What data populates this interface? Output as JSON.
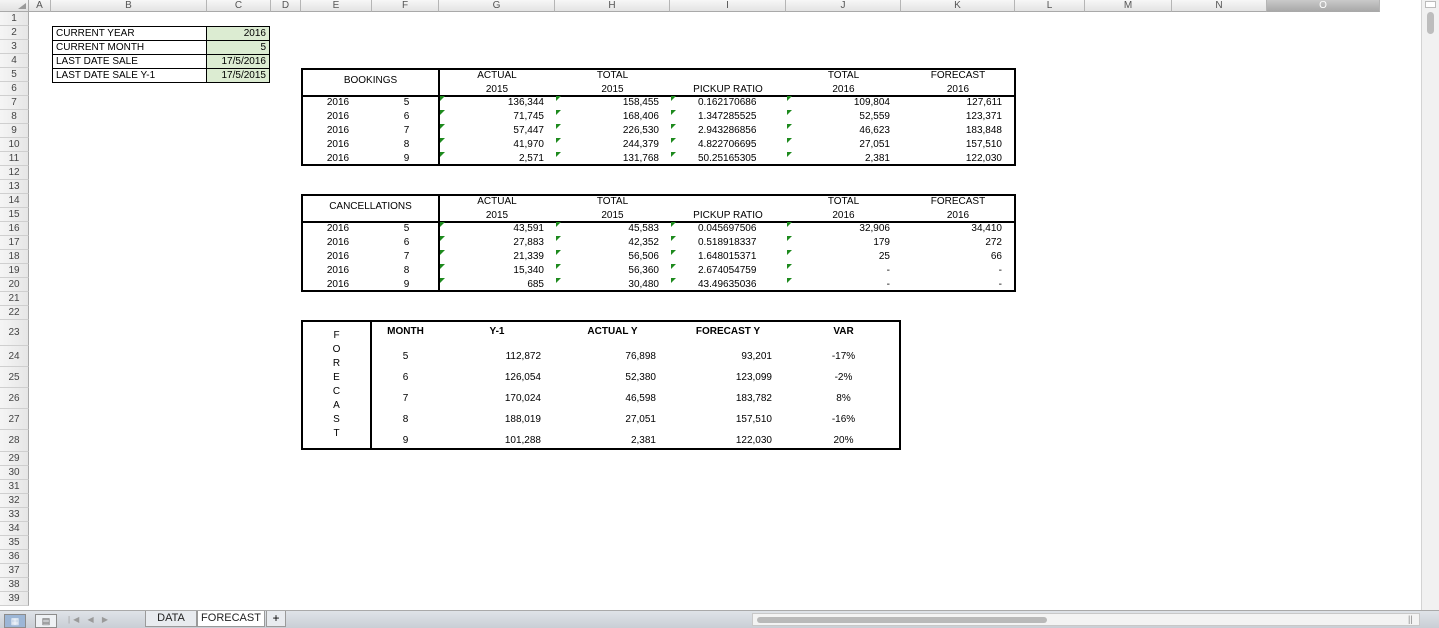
{
  "columns": [
    "A",
    "B",
    "C",
    "D",
    "E",
    "F",
    "G",
    "H",
    "I",
    "J",
    "K",
    "L",
    "M",
    "N",
    "O"
  ],
  "rows": [
    "1",
    "2",
    "3",
    "4",
    "5",
    "6",
    "7",
    "8",
    "9",
    "10",
    "11",
    "12",
    "13",
    "14",
    "15",
    "16",
    "17",
    "18",
    "19",
    "20",
    "21",
    "22",
    "23",
    "24",
    "25",
    "26",
    "27",
    "28",
    "29",
    "30",
    "31",
    "32",
    "33",
    "34",
    "35",
    "36",
    "37",
    "38",
    "39"
  ],
  "info": [
    {
      "label": "CURRENT YEAR",
      "value": "2016"
    },
    {
      "label": "CURRENT MONTH",
      "value": "5"
    },
    {
      "label": "LAST DATE SALE",
      "value": "17/5/2016"
    },
    {
      "label": "LAST DATE SALE Y-1",
      "value": "17/5/2015"
    }
  ],
  "bookings": {
    "title": "BOOKINGS",
    "headers": {
      "actual": [
        "ACTUAL",
        "2015"
      ],
      "total2015": [
        "TOTAL",
        "2015"
      ],
      "pickup": "PICKUP RATIO",
      "total2016": [
        "TOTAL",
        "2016"
      ],
      "forecast": [
        "FORECAST",
        "2016"
      ]
    },
    "rows": [
      {
        "year": "2016",
        "month": "5",
        "actual": "136,344",
        "total2015": "158,455",
        "pickup": "0.162170686",
        "total2016": "109,804",
        "forecast": "127,611"
      },
      {
        "year": "2016",
        "month": "6",
        "actual": "71,745",
        "total2015": "168,406",
        "pickup": "1.347285525",
        "total2016": "52,559",
        "forecast": "123,371"
      },
      {
        "year": "2016",
        "month": "7",
        "actual": "57,447",
        "total2015": "226,530",
        "pickup": "2.943286856",
        "total2016": "46,623",
        "forecast": "183,848"
      },
      {
        "year": "2016",
        "month": "8",
        "actual": "41,970",
        "total2015": "244,379",
        "pickup": "4.822706695",
        "total2016": "27,051",
        "forecast": "157,510"
      },
      {
        "year": "2016",
        "month": "9",
        "actual": "2,571",
        "total2015": "131,768",
        "pickup": "50.25165305",
        "total2016": "2,381",
        "forecast": "122,030"
      }
    ]
  },
  "cancellations": {
    "title": "CANCELLATIONS",
    "headers": {
      "actual": [
        "ACTUAL",
        "2015"
      ],
      "total2015": [
        "TOTAL",
        "2015"
      ],
      "pickup": "PICKUP RATIO",
      "total2016": [
        "TOTAL",
        "2016"
      ],
      "forecast": [
        "FORECAST",
        "2016"
      ]
    },
    "rows": [
      {
        "year": "2016",
        "month": "5",
        "actual": "43,591",
        "total2015": "45,583",
        "pickup": "0.045697506",
        "total2016": "32,906",
        "forecast": "34,410"
      },
      {
        "year": "2016",
        "month": "6",
        "actual": "27,883",
        "total2015": "42,352",
        "pickup": "0.518918337",
        "total2016": "179",
        "forecast": "272"
      },
      {
        "year": "2016",
        "month": "7",
        "actual": "21,339",
        "total2015": "56,506",
        "pickup": "1.648015371",
        "total2016": "25",
        "forecast": "66"
      },
      {
        "year": "2016",
        "month": "8",
        "actual": "15,340",
        "total2015": "56,360",
        "pickup": "2.674054759",
        "total2016": "-",
        "forecast": "-"
      },
      {
        "year": "2016",
        "month": "9",
        "actual": "685",
        "total2015": "30,480",
        "pickup": "43.49635036",
        "total2016": "-",
        "forecast": "-"
      }
    ]
  },
  "forecast": {
    "vertical_label": [
      "F",
      "O",
      "R",
      "E",
      "C",
      "A",
      "S",
      "T"
    ],
    "headers": {
      "month": "MONTH",
      "y1": "Y-1",
      "actual": "ACTUAL Y",
      "forecast": "FORECAST Y",
      "var": "VAR"
    },
    "rows": [
      {
        "month": "5",
        "y1": "112,872",
        "actual": "76,898",
        "forecast": "93,201",
        "var": "-17%"
      },
      {
        "month": "6",
        "y1": "126,054",
        "actual": "52,380",
        "forecast": "123,099",
        "var": "-2%"
      },
      {
        "month": "7",
        "y1": "170,024",
        "actual": "46,598",
        "forecast": "183,782",
        "var": "8%"
      },
      {
        "month": "8",
        "y1": "188,019",
        "actual": "27,051",
        "forecast": "157,510",
        "var": "-16%"
      },
      {
        "month": "9",
        "y1": "101,288",
        "actual": "2,381",
        "forecast": "122,030",
        "var": "20%"
      }
    ]
  },
  "sheet_tabs": [
    {
      "label": "DATA",
      "active": false
    },
    {
      "label": "FORECAST",
      "active": true
    }
  ],
  "add_tab_label": "+",
  "colors": {
    "highlight_green": "#dcecd2",
    "error_triangle": "#1d8a1d",
    "selected_header": "#a9a9a9"
  }
}
